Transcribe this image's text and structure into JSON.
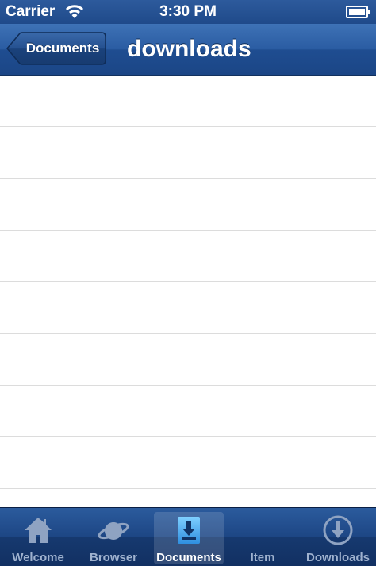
{
  "status_bar": {
    "carrier": "Carrier",
    "time": "3:30 PM"
  },
  "nav": {
    "back_label": "Documents",
    "title": "downloads"
  },
  "table": {
    "rows": [
      "",
      "",
      "",
      "",
      "",
      "",
      "",
      "",
      ""
    ]
  },
  "tabs": [
    {
      "label": "Welcome",
      "icon": "home-icon",
      "selected": false
    },
    {
      "label": "Browser",
      "icon": "planet-icon",
      "selected": false
    },
    {
      "label": "Documents",
      "icon": "download-box-icon",
      "selected": true
    },
    {
      "label": "Item",
      "icon": "",
      "selected": false
    },
    {
      "label": "Downloads",
      "icon": "download-circle-icon",
      "selected": false
    }
  ],
  "colors": {
    "bar_blue": "#1f4d91",
    "separator": "#dcdcdc",
    "selected_icon": "#4aa8f0"
  }
}
